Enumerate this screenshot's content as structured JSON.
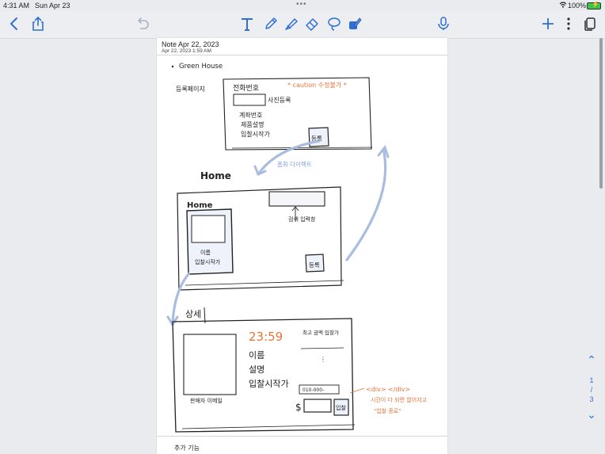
{
  "status_bar": {
    "time": "4:31 AM",
    "date": "Sun Apr 23",
    "battery_percent": "100%",
    "battery_level": 1.0
  },
  "toolbar": {
    "icons": [
      "back-chevron-icon",
      "share-icon",
      "undo-icon",
      "text-tool-icon",
      "pen-icon",
      "highlighter-icon",
      "eraser-icon",
      "lasso-icon",
      "shapes-icon",
      "microphone-icon",
      "add-icon",
      "more-icon",
      "pages-icon"
    ]
  },
  "note": {
    "title": "Note Apr 22, 2023",
    "datetime": "Apr 22, 2023 1:59 AM"
  },
  "sketch": {
    "section1_bullet": "Green House",
    "section1_label": "등록페이지",
    "phone_label": "전화번호",
    "caution_note": "* caution 수정불가 *",
    "photo_register": "사진등록",
    "field_lines": [
      "계좌번호",
      "제품설명",
      "입찰시작가"
    ],
    "register_button": "등록",
    "home_heading": "Home",
    "flow_label": "홈화 다이렉트",
    "home_box_title": "Home",
    "search_note": "검색 입력창",
    "item_labels": [
      "이름",
      "입찰시작가"
    ],
    "detail_heading": "상세",
    "timer": "23:59",
    "bid_header_left": "최고 금액",
    "bid_header_right": "입찰가",
    "detail_info": [
      "이름",
      "설명",
      "입찰시작가"
    ],
    "phone_hint": "010-000-",
    "currency_mark": "$",
    "bid_button": "입찰",
    "detail_caption": "판매자 이메일",
    "div_note": "<div> </div>",
    "div_note_line2": "시간이 다 되면 없어지고",
    "div_note_line3": "\"입찰 종료\"",
    "footer_text": "추가 기능"
  },
  "page_nav": {
    "current": "1",
    "separator": "/",
    "total": "3"
  },
  "colors": {
    "accent": "#2f6fd6",
    "ink": "#222222",
    "orange_ink": "#e8743b",
    "blue_ink": "#7f9fd4"
  }
}
